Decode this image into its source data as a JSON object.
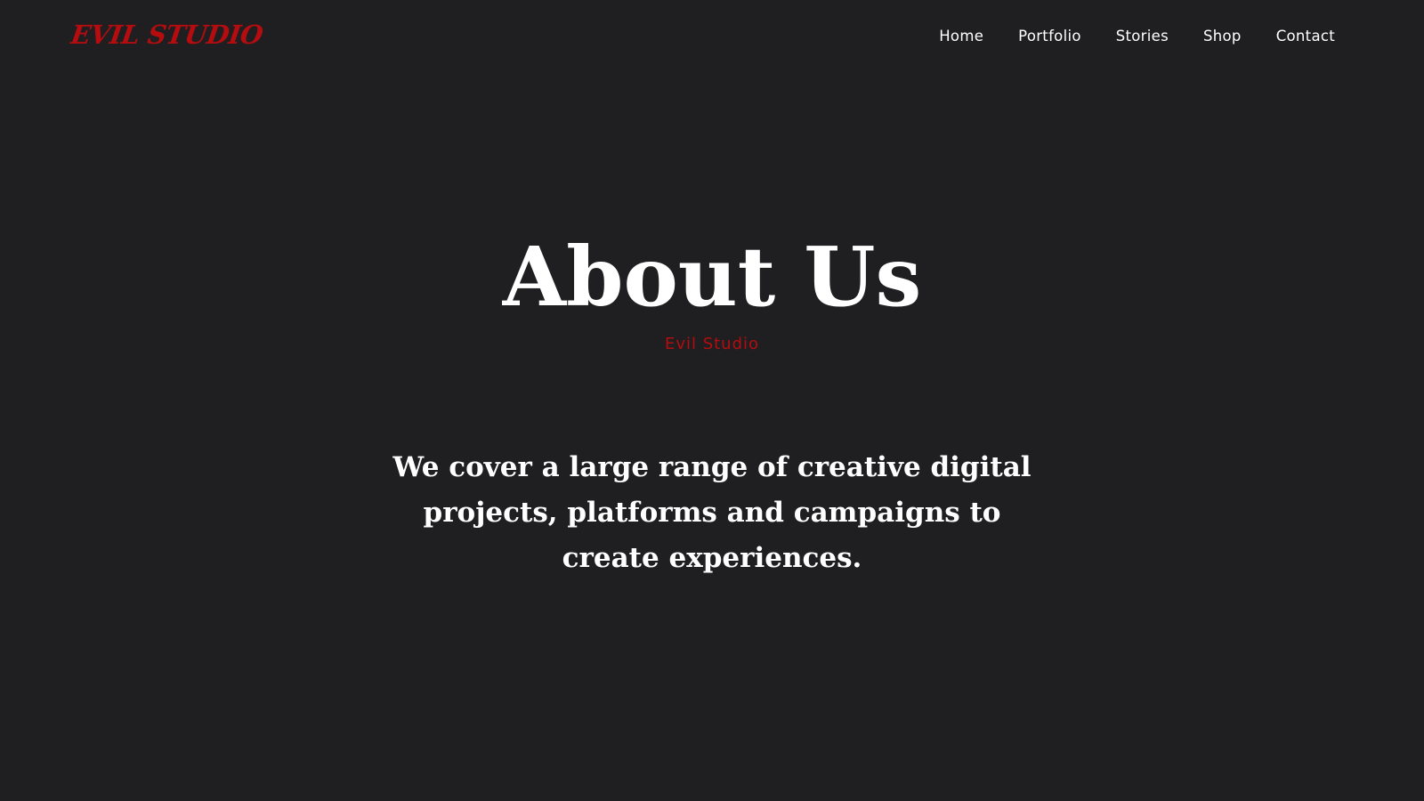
{
  "header": {
    "logo_text": "EVIL STUDIO",
    "nav": [
      {
        "label": "Home"
      },
      {
        "label": "Portfolio"
      },
      {
        "label": "Stories"
      },
      {
        "label": "Shop"
      },
      {
        "label": "Contact"
      }
    ]
  },
  "hero": {
    "title": "About Us",
    "subtitle": "Evil Studio",
    "tagline": "We cover a large range of creative digital projects, platforms and campaigns to create experiences."
  },
  "colors": {
    "background": "#1f1e21",
    "accent": "#b50d0f",
    "text": "#ffffff"
  }
}
